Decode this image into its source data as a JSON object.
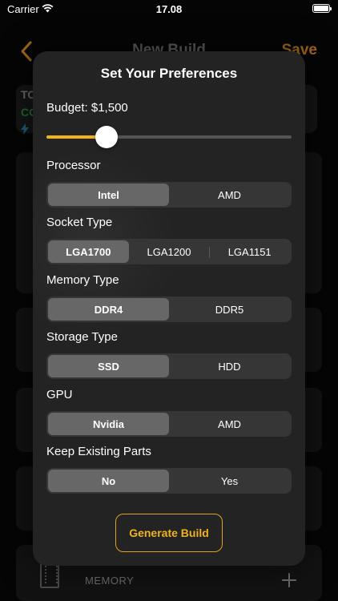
{
  "status_bar": {
    "carrier": "Carrier",
    "time": "17.08"
  },
  "background": {
    "nav_title": "New Build",
    "save_label": "Save",
    "summary_total": "TO",
    "summary_compat": "CO",
    "memory_label": "MEMORY"
  },
  "modal": {
    "title": "Set Your Preferences",
    "budget_label": "Budget: $1,500",
    "budget_slider_fraction": 0.245,
    "sections": [
      {
        "label": "Processor",
        "options": [
          "Intel",
          "AMD"
        ],
        "selected": 0
      },
      {
        "label": "Socket Type",
        "options": [
          "LGA1700",
          "LGA1200",
          "LGA1151"
        ],
        "selected": 0
      },
      {
        "label": "Memory Type",
        "options": [
          "DDR4",
          "DDR5"
        ],
        "selected": 0
      },
      {
        "label": "Storage Type",
        "options": [
          "SSD",
          "HDD"
        ],
        "selected": 0
      },
      {
        "label": "GPU",
        "options": [
          "Nvidia",
          "AMD"
        ],
        "selected": 0
      },
      {
        "label": "Keep Existing Parts",
        "options": [
          "No",
          "Yes"
        ],
        "selected": 0
      }
    ],
    "generate_label": "Generate Build"
  },
  "colors": {
    "accent": "#f0b21f",
    "compat_green": "#1f6a33",
    "background": "#050505",
    "modal_bg": "#232323"
  },
  "icons": [
    "wifi-icon",
    "battery-icon",
    "chevron-left-icon",
    "bolt-icon",
    "memory-icon",
    "plus-icon"
  ]
}
